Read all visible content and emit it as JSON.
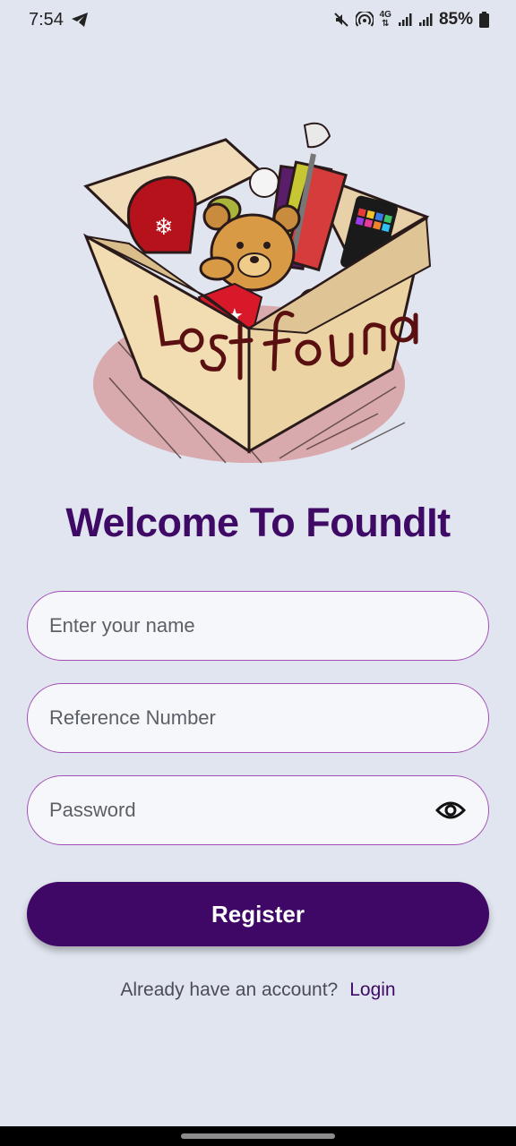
{
  "status_bar": {
    "time": "7:54",
    "network_label": "4G",
    "battery": "85%",
    "icons": [
      "telegram-icon",
      "mute-icon",
      "hotspot-icon",
      "signal-icon",
      "signal-icon",
      "battery-icon"
    ]
  },
  "illustration": {
    "box_text_left": "lost",
    "box_text_right": "found"
  },
  "welcome_title": "Welcome To FoundIt",
  "form": {
    "name_placeholder": "Enter your name",
    "reference_placeholder": "Reference Number",
    "password_placeholder": "Password",
    "password_toggle_icon": "eye-icon",
    "register_label": "Register"
  },
  "footer": {
    "prompt": "Already have an account?",
    "login_label": "Login"
  },
  "colors": {
    "background": "#e1e5ef",
    "primary": "#3f0866",
    "field_border": "#a24fb5"
  }
}
